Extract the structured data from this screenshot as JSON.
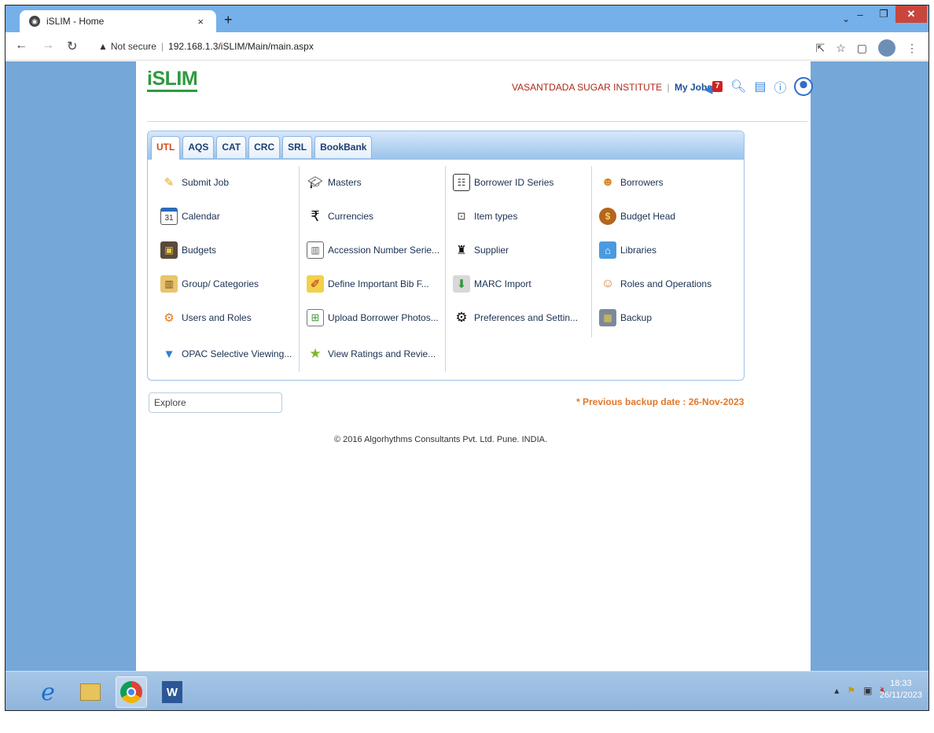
{
  "browser": {
    "tab_title": "iSLIM - Home",
    "tab_close": "×",
    "new_tab": "+",
    "address": {
      "security": "Not secure",
      "url": "192.168.1.3/iSLIM/Main/main.aspx"
    }
  },
  "header": {
    "logo": "iSLIM",
    "organization": "VASANTDADA SUGAR INSTITUTE",
    "separator": "|",
    "my_jobs": "My Jobs",
    "separator2": "|",
    "notification_count": "7"
  },
  "tabs": [
    {
      "label": "UTL",
      "active": true
    },
    {
      "label": "AQS",
      "active": false
    },
    {
      "label": "CAT",
      "active": false
    },
    {
      "label": "CRC",
      "active": false
    },
    {
      "label": "SRL",
      "active": false
    },
    {
      "label": "BookBank",
      "active": false
    }
  ],
  "menu": {
    "col1": [
      {
        "label": "Submit Job",
        "icon": "pencil-icon"
      },
      {
        "label": "Calendar",
        "icon": "calendar-icon"
      },
      {
        "label": "Budgets",
        "icon": "wallet-icon"
      },
      {
        "label": "Group/ Categories",
        "icon": "folder-icon"
      },
      {
        "label": "Users and Roles",
        "icon": "users-gear-icon"
      },
      {
        "label": "OPAC Selective Viewing...",
        "icon": "filter-icon"
      }
    ],
    "col2": [
      {
        "label": "Masters",
        "icon": "graduation-cap-icon"
      },
      {
        "label": "Currencies",
        "icon": "rupee-icon"
      },
      {
        "label": "Accession Number Serie...",
        "icon": "shelf-icon"
      },
      {
        "label": "Define Important Bib F...",
        "icon": "note-pen-icon"
      },
      {
        "label": "Upload Borrower Photos...",
        "icon": "upload-photo-icon"
      },
      {
        "label": "View Ratings and Revie...",
        "icon": "star-icon"
      }
    ],
    "col3": [
      {
        "label": "Borrower ID Series",
        "icon": "id-card-icon"
      },
      {
        "label": "Item types",
        "icon": "item-types-icon"
      },
      {
        "label": "Supplier",
        "icon": "supplier-icon"
      },
      {
        "label": "MARC Import",
        "icon": "import-icon"
      },
      {
        "label": "Preferences and Settin...",
        "icon": "gears-icon"
      }
    ],
    "col4": [
      {
        "label": "Borrowers",
        "icon": "borrowers-icon"
      },
      {
        "label": "Budget Head",
        "icon": "money-bag-icon"
      },
      {
        "label": "Libraries",
        "icon": "library-icon"
      },
      {
        "label": "Roles and Operations",
        "icon": "roles-icon"
      },
      {
        "label": "Backup",
        "icon": "backup-icon"
      }
    ]
  },
  "explore_placeholder": "Explore",
  "backup_notice": "* Previous backup date : 26-Nov-2023",
  "footer": "© 2016 Algorhythms Consultants Pvt. Ltd. Pune. INDIA.",
  "taskbar": {
    "time": "18:33",
    "date": "26/11/2023"
  },
  "colors": {
    "logo": "#2f9a3e",
    "organization": "#b0271a",
    "active_tab": "#d04818",
    "backup_notice": "#e0782b",
    "page_background": "#75a7d8"
  }
}
